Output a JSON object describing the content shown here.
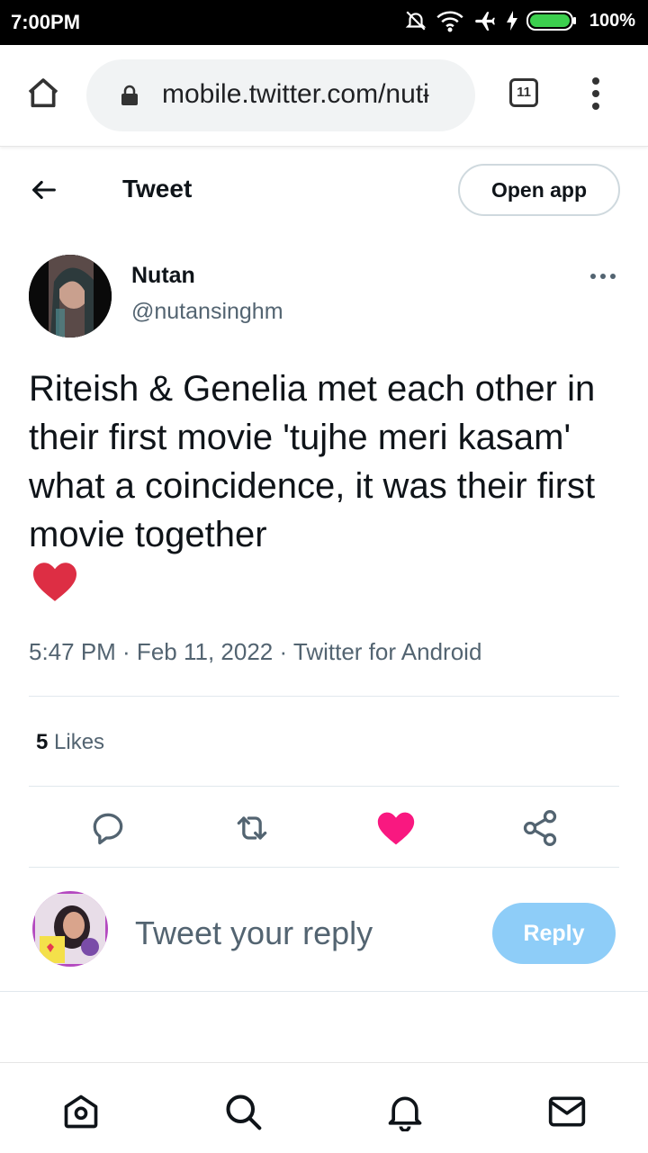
{
  "status_bar": {
    "time": "7:00PM",
    "battery": "100%"
  },
  "browser": {
    "url": "mobile.twitter.com/nutɨ",
    "tab_count": "11"
  },
  "header": {
    "title": "Tweet",
    "open_app": "Open app"
  },
  "tweet": {
    "author_name": "Nutan",
    "author_handle": "@nutansinghm",
    "text": "Riteish & Genelia met each other in their first movie 'tujhe meri kasam' what a coincidence, it was their first movie together",
    "meta": "5:47 PM · Feb 11, 2022 · Twitter for Android",
    "likes_count": "5",
    "likes_label": "Likes"
  },
  "reply": {
    "placeholder": "Tweet your reply",
    "button": "Reply"
  },
  "colors": {
    "accent": "#1d9bf0",
    "like": "#f91880",
    "reply_button": "#8ecdf8",
    "secondary_text": "#536471"
  },
  "icons": [
    "home-icon",
    "lock-icon",
    "menu-icon",
    "back-arrow-icon",
    "reply-icon",
    "retweet-icon",
    "like-icon",
    "share-icon",
    "search-icon",
    "notifications-icon",
    "messages-icon"
  ]
}
